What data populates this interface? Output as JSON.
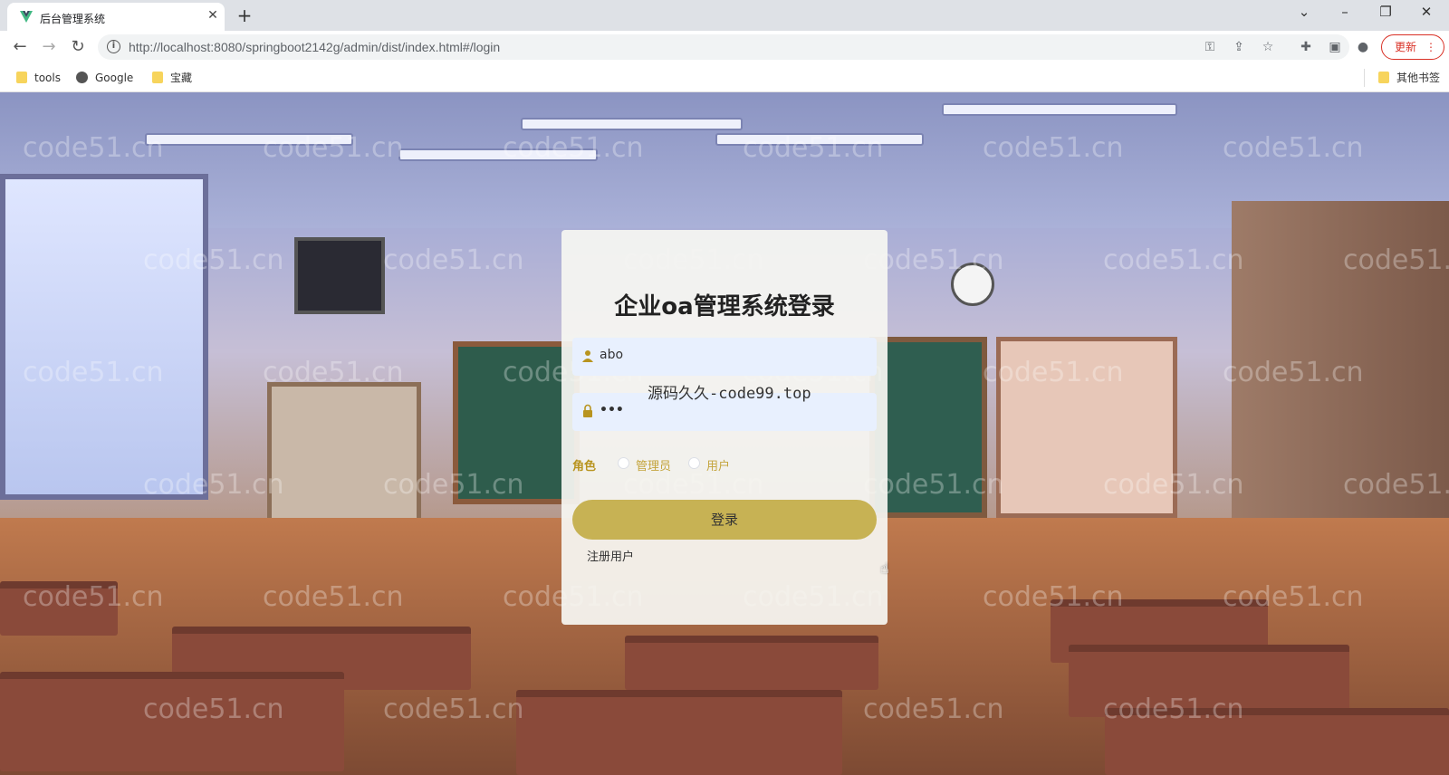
{
  "browser": {
    "tab_title": "后台管理系统",
    "tab_close": "✕",
    "new_tab": "+",
    "url": "http://localhost:8080/springboot2142g/admin/dist/index.html#/login",
    "update_label": "更新",
    "bookmarks": [
      "tools",
      "Google",
      "宝藏"
    ],
    "other_bookmarks": "其他书签"
  },
  "watermark_text": "code51.cn",
  "login": {
    "title": "企业oa管理系统登录",
    "username_value": "abo",
    "password_value": "•••",
    "overlay_text": "源码久久-code99.top",
    "role_label": "角色",
    "roles": [
      "管理员",
      "用户"
    ],
    "login_button": "登录",
    "register_link": "注册用户"
  },
  "colors": {
    "accent": "#c7b254",
    "role_text": "#c4a43c",
    "input_bg": "#e8f0fe"
  }
}
